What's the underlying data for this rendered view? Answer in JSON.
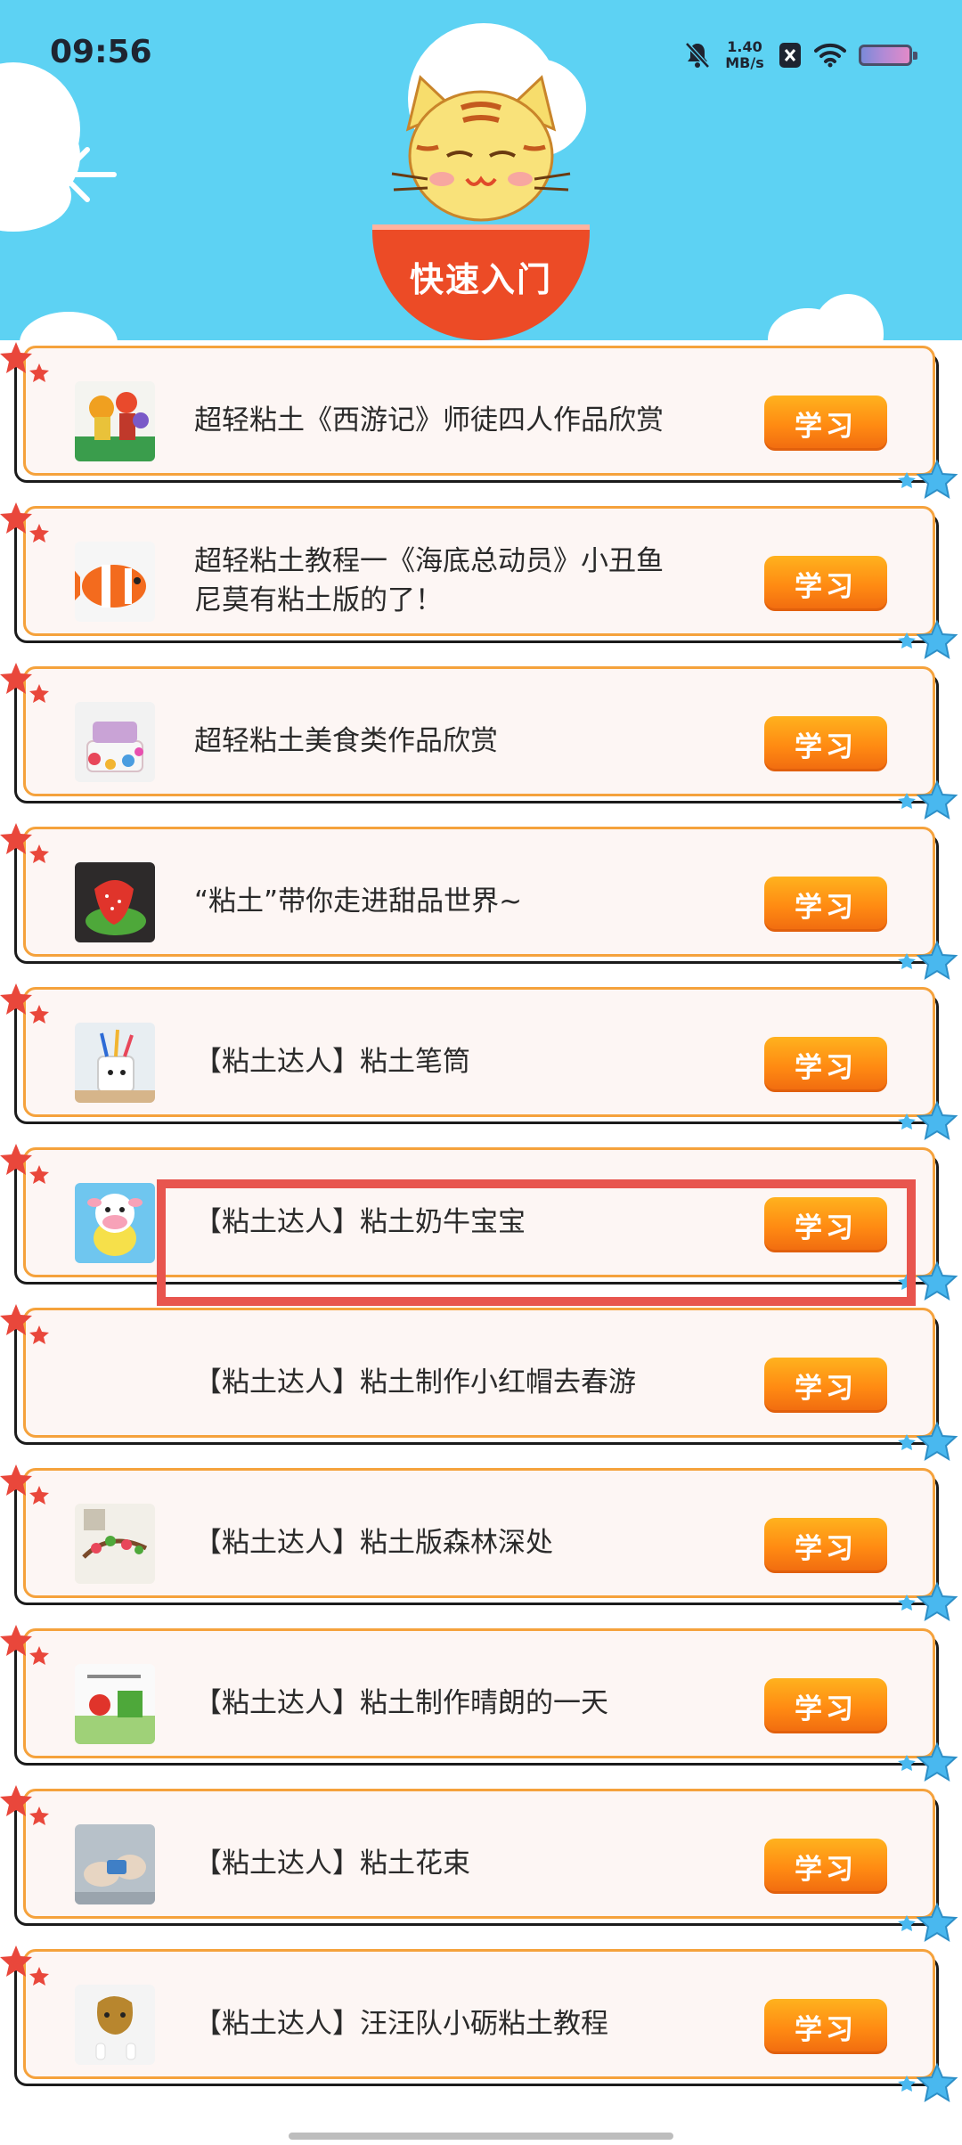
{
  "status_bar": {
    "time": "09:56",
    "net_speed_value": "1.40",
    "net_speed_unit": "MB/s",
    "icons": [
      "bell-mute-icon",
      "no-sim-icon",
      "wifi-icon",
      "battery-icon"
    ]
  },
  "header": {
    "title": "快速入门",
    "back_icon": "back-arrow-icon",
    "mascot": "cat-chef-mascot",
    "colors": {
      "sky": "#5dd2f3",
      "bowl": "#ec4b26"
    }
  },
  "items": [
    {
      "title": "超轻粘土《西游记》师徒四人作品欣赏",
      "button": "学习",
      "thumb": "journey-west-clay"
    },
    {
      "title": "超轻粘土教程一《海底总动员》小丑鱼\n尼莫有粘土版的了！",
      "button": "学习",
      "thumb": "clownfish-clay"
    },
    {
      "title": "超轻粘土美食类作品欣赏",
      "button": "学习",
      "thumb": "cake-clay"
    },
    {
      "title": "“粘土”带你走进甜品世界~",
      "button": "学习",
      "thumb": "strawberry-dessert"
    },
    {
      "title": "【粘土达人】粘土笔筒",
      "button": "学习",
      "thumb": "pen-holder-clay"
    },
    {
      "title": "【粘土达人】粘土奶牛宝宝",
      "button": "学习",
      "thumb": "baby-cow-clay"
    },
    {
      "title": "【粘土达人】粘土制作小红帽去春游",
      "button": "学习",
      "thumb": ""
    },
    {
      "title": "【粘土达人】粘土版森林深处",
      "button": "学习",
      "thumb": "forest-clay"
    },
    {
      "title": "【粘土达人】粘土制作晴朗的一天",
      "button": "学习",
      "thumb": "sunny-day-clay"
    },
    {
      "title": "【粘土达人】粘土花束",
      "button": "学习",
      "thumb": "flower-bouquet-clay"
    },
    {
      "title": "【粘土达人】汪汪队小砺粘土教程",
      "button": "学习",
      "thumb": "paw-patrol-clay"
    }
  ],
  "colors": {
    "card_border": "#f5a23c",
    "card_bg": "#fdf6f4",
    "button_gradient": [
      "#ffb21e",
      "#f06a10"
    ],
    "highlight": "#e8554e"
  }
}
